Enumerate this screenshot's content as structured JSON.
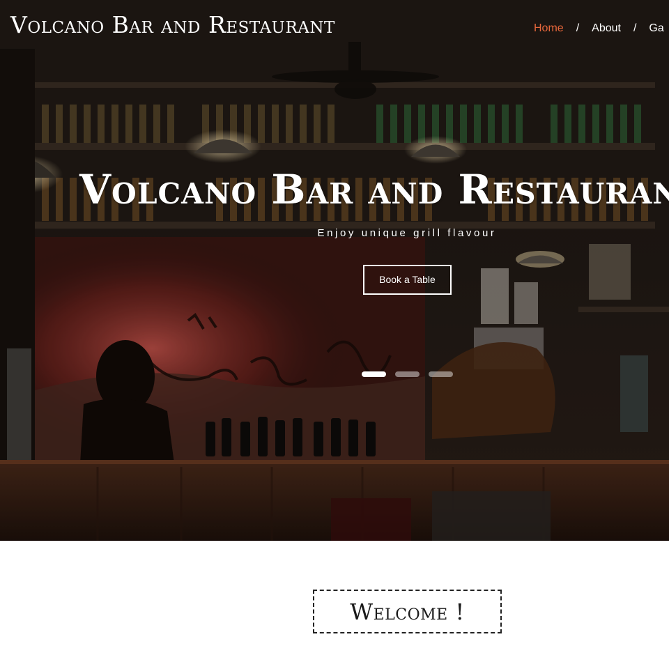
{
  "brand": {
    "name": "Volcano Bar and Restaurant"
  },
  "nav": {
    "items": [
      {
        "label": "Home",
        "active": true
      },
      {
        "label": "About",
        "active": false
      },
      {
        "label": "Ga",
        "active": false
      }
    ],
    "separator": "/",
    "active_color": "#e8673b"
  },
  "hero": {
    "title": "Volcano Bar and Restaurant",
    "subtitle": "Enjoy unique grill flavour",
    "button_label": "Book a Table",
    "background_image": "bar-interior-photo",
    "slides": {
      "count": 3,
      "active_index": 0
    }
  },
  "welcome": {
    "title": "Welcome !"
  }
}
